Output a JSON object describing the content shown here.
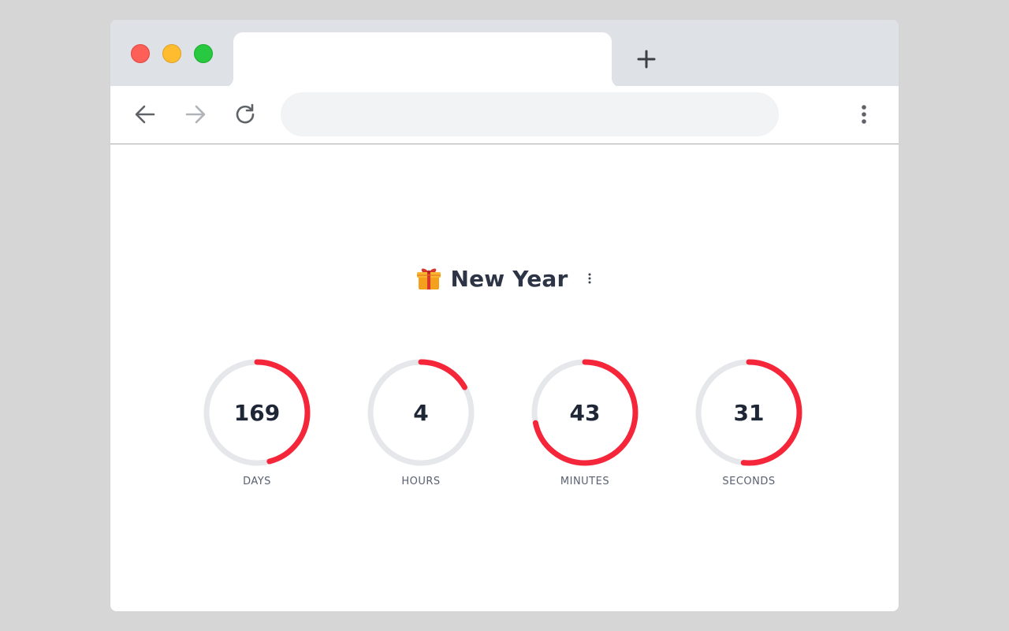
{
  "browser": {
    "tab_title": "",
    "address": "",
    "address_placeholder": "",
    "colors": {
      "tabstrip": "#dee1e6",
      "close": "#fe5f57",
      "minimize": "#febc2e",
      "maximize": "#28c840"
    }
  },
  "page": {
    "title": "New Year",
    "title_icon": "gift-icon"
  },
  "countdown": {
    "accent": "#f5263a",
    "track": "#e5e7eb",
    "units": [
      {
        "key": "days",
        "value": "169",
        "label": "DAYS",
        "fraction": 0.46
      },
      {
        "key": "hours",
        "value": "4",
        "label": "HOURS",
        "fraction": 0.1667
      },
      {
        "key": "minutes",
        "value": "43",
        "label": "MINUTES",
        "fraction": 0.7167
      },
      {
        "key": "seconds",
        "value": "31",
        "label": "SECONDS",
        "fraction": 0.5167
      }
    ]
  }
}
